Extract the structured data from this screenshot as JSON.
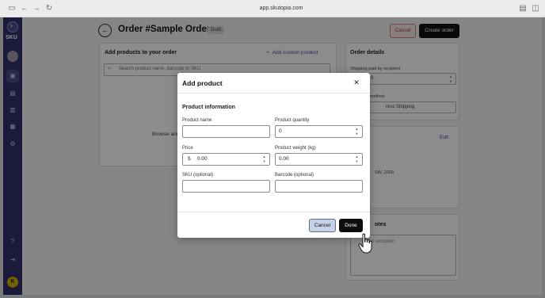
{
  "browser": {
    "url": "app.skutopia.com"
  },
  "sidebar": {
    "logo": "SKU",
    "avatar_initial": "K"
  },
  "header": {
    "title": "Order #Sample Order",
    "badge": "Draft",
    "cancel_label": "Cancel",
    "create_label": "Create order"
  },
  "products_card": {
    "title": "Add products to your order",
    "custom_product_label": "Add custom product",
    "search_placeholder": "Search product name, barcode or SKU",
    "browse_text": "Browse and"
  },
  "order_details": {
    "title": "Order details",
    "shipping_paid_label": "Shipping paid by recipient",
    "shipping_paid_value": "0",
    "method_label": "method",
    "method_value": "ress Shipping"
  },
  "recipient_card": {
    "edit_label": "Edit",
    "address_fragment": "SW, 2000"
  },
  "notes_card": {
    "title": "otes",
    "placeholder": "at reception"
  },
  "modal": {
    "title": "Add product",
    "section_title": "Product information",
    "fields": {
      "product_name": {
        "label": "Product name",
        "value": ""
      },
      "product_quantity": {
        "label": "Product quantity",
        "value": "0"
      },
      "price": {
        "label": "Price",
        "prefix": "$",
        "value": "0.00"
      },
      "product_weight": {
        "label": "Product weight (kg)",
        "value": "0.00"
      },
      "sku": {
        "label": "SKU (optional)",
        "value": ""
      },
      "barcode": {
        "label": "Barcode (optional)",
        "value": ""
      }
    },
    "cancel_label": "Cancel",
    "done_label": "Done"
  }
}
